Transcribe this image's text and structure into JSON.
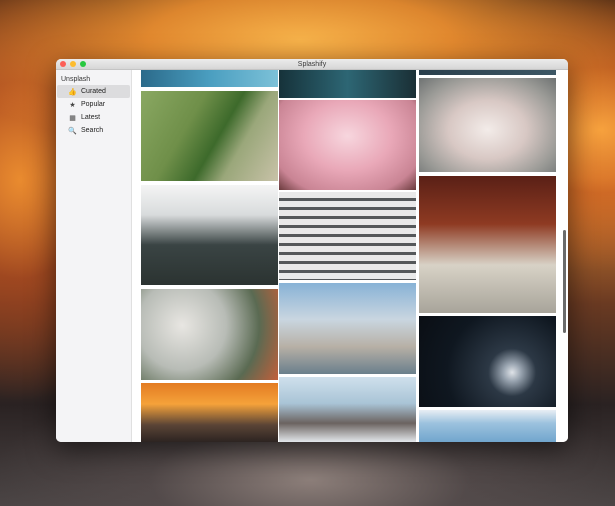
{
  "window": {
    "title": "Splashify"
  },
  "sidebar": {
    "header": "Unsplash",
    "items": [
      {
        "label": "Curated",
        "icon": "thumbs-up-icon",
        "glyph": "👍",
        "active": true
      },
      {
        "label": "Popular",
        "icon": "star-icon",
        "glyph": "★",
        "active": false
      },
      {
        "label": "Latest",
        "icon": "calendar-icon",
        "glyph": "▦",
        "active": false
      },
      {
        "label": "Search",
        "icon": "search-icon",
        "glyph": "🔍",
        "active": false
      }
    ]
  },
  "photos": [
    {
      "name": "photo-ocean-aerial",
      "style": "linear-gradient(90deg,#2b6a8a,#4a9ec0,#7cc1d8)"
    },
    {
      "name": "photo-green-fields",
      "style": "linear-gradient(120deg,#8aa862 0%,#6f8f49 35%,#3d6a2b 55%,#9aa77a 70%,#c8c2a8 100%)"
    },
    {
      "name": "photo-misty-forest",
      "style": "linear-gradient(180deg,#f4f4f4 0%,#d8dbdc 30%,#3a4444 60%,#2b3331 100%)"
    },
    {
      "name": "photo-flowering-branches",
      "style": "radial-gradient(circle at 30% 40%,#e8e6e2 0%,#b8bcb6 40%,#5a6a52 70%,#c25f3a 100%)"
    },
    {
      "name": "photo-sunset-clouds",
      "style": "linear-gradient(180deg,#e37b22 0%,#f5a23a 35%,#5a4436 70%,#2a2220 100%)"
    },
    {
      "name": "photo-waterfall",
      "style": "linear-gradient(90deg,#16323a,#2d6674,#1a2f35)"
    },
    {
      "name": "photo-cherry-blossom-woman",
      "style": "radial-gradient(ellipse at 50% 40%,#f7d6de 0%,#e9a8b8 45%,#c98494 80%,#6a3a3c 100%)"
    },
    {
      "name": "photo-building-facade",
      "style": "repeating-linear-gradient(180deg,#e9e9e9 0px,#e9e9e9 6px,#55585a 6px,#55585a 9px)"
    },
    {
      "name": "photo-snow-monkey",
      "style": "linear-gradient(180deg,#88b2d6 0%,#c9d6e0 40%,#b7b0a6 70%,#6a7f8c 100%)"
    },
    {
      "name": "photo-rocky-peaks",
      "style": "linear-gradient(180deg,#cfe0ec 0%,#a9c4d6 40%,#6b6360 70%,#e9eef2 100%)"
    },
    {
      "name": "photo-dark-strip",
      "style": "linear-gradient(90deg,#2a3f4c,#3d5765)"
    },
    {
      "name": "photo-flamingos",
      "style": "radial-gradient(ellipse at 50% 55%,#f3ece9 0%,#d8c8c4 40%,#9a9a96 75%,#6e7272 100%)"
    },
    {
      "name": "photo-dining-hall",
      "style": "linear-gradient(180deg,#5a2016 0%,#8e3a22 35%,#d8d2c6 65%,#a8a49a 100%)"
    },
    {
      "name": "photo-moon",
      "style": "radial-gradient(circle at 68% 62%,#dfe3e8 0%,#9aa5b1 8%,#2c3845 22%,#0f1720 60%,#0a0e14 100%)"
    },
    {
      "name": "photo-sky-clouds",
      "style": "linear-gradient(180deg,#e8eef4 0%,#9cc2de 40%,#6fa4cc 100%)"
    }
  ]
}
